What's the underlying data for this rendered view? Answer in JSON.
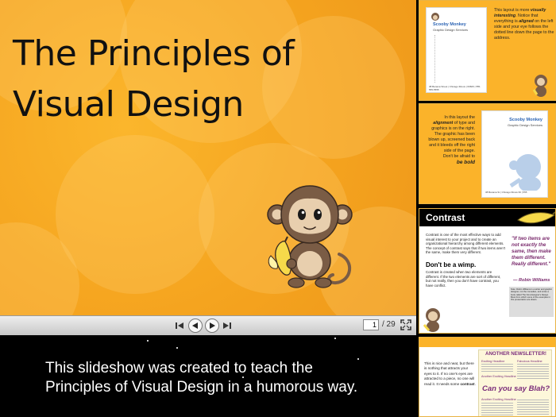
{
  "main_slide": {
    "title": "The Principles of\nVisual Design"
  },
  "controller": {
    "current_page": "1",
    "total_pages": "/ 29"
  },
  "caption": "This slideshow was created to teach the\nPrinciples of Visual Design in a humorous way.",
  "thumbnails": [
    {
      "brand": "Scooby Monkey",
      "brand_sub": "Graphic Design Services",
      "text_1": "This layout is more ",
      "text_1_em": "visually interesting",
      "text_2": ". Notice that everything is ",
      "text_2_em": "aligned",
      "text_3": " on the left side and your eye follows the dotted line down the page to the address.",
      "address": "38 Banana Street | Chicago Illinois | 60606 | 555-555-5555"
    },
    {
      "text_1": "In this layout the ",
      "text_1_em": "alignment",
      "text_2": " of type and graphics is on the right. The graphic has been blown up,  screened back and it bleeds off the right side of the page.",
      "text_3": "Don't be afraid to ",
      "text_3_em": "be bold",
      "brand": "Scooby Monkey",
      "brand_sub": "Graphic Design Services",
      "address": "38 Banana St | Chicago Illinois 60 | 555"
    },
    {
      "title": "Contrast",
      "body": "Contrast is one of the most effective ways to add visual interest to your project and to create an organizational hierarchy among different elements. The concept of contrast says that if two items aren't the same, make them very different.",
      "heading": "Don't be a wimp.",
      "body_2": "Contrast is created when two elements are different. If the two elements are sort of different, but not really, then you don't have contrast, you have conflict.",
      "quote": "\"If two items are not exactly the same, then make them different. Really different.\"",
      "quote_author": "— Robin Williams",
      "note": "Note: Robin Williams is a writer and graphic designer, not the comedian, and wrote a book called The Non-Designer's Design Book from which some of the examples in this presentation are drawn."
    },
    {
      "text": "This is nice and neat, but there is nothing that attracts your eyes to it. If no one's eyes are attracted to a piece, no one will read it. It needs some ",
      "text_em": "contrast",
      "newsletter_title": "ANOTHER NEWSLETTER!",
      "headline_1": "Exciting Headline",
      "headline_2": "Another Exciting Headline",
      "headline_3": "Fabulous Headline",
      "headline_4": "Another Exciting Headline",
      "callout": "Can you say Blah?"
    }
  ],
  "colors": {
    "slide_orange": "#f5a41f",
    "brand_blue": "#2c64b4",
    "quote_purple": "#7b2c6e",
    "newsletter_purple": "#7b2d7a"
  }
}
